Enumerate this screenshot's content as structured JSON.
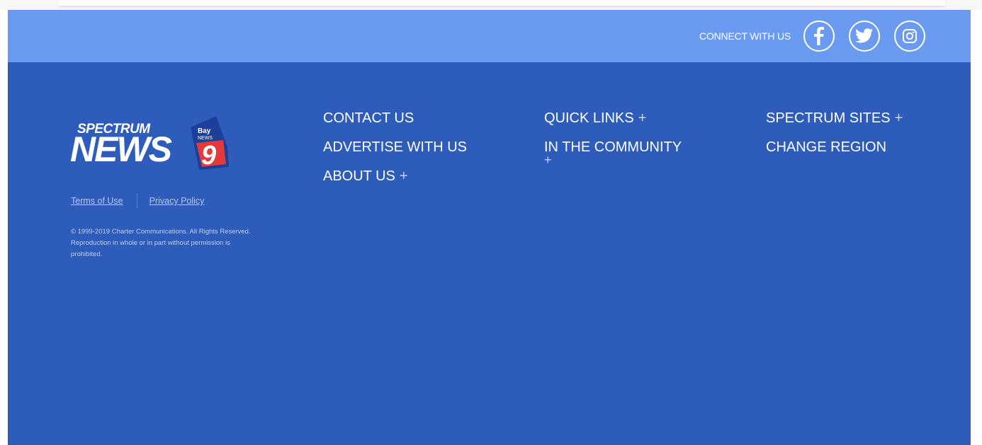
{
  "connect": {
    "label": "CONNECT WITH US",
    "social": [
      "facebook-icon",
      "twitter-icon",
      "instagram-icon"
    ]
  },
  "logo": {
    "line1": "SPECTRUM",
    "line2": "NEWS",
    "badge_top": "Bay",
    "badge_mid": "NEWS",
    "badge_num": "9"
  },
  "legal": {
    "terms": "Terms of Use",
    "privacy": "Privacy Policy",
    "copyright": "© 1999-2019 Charter Communications. All Rights Reserved. Reproduction in whole or in part without permission is prohibited."
  },
  "nav": {
    "col1": [
      "CONTACT US",
      "ADVERTISE WITH US",
      "ABOUT US"
    ],
    "col2": [
      "QUICK LINKS",
      "IN THE COMMUNITY"
    ],
    "col3": [
      "SPECTRUM SITES",
      "CHANGE REGION"
    ],
    "plus": "+"
  },
  "colors": {
    "connect_bar": "#6b9bf0",
    "footer": "#2e5cbb",
    "badge_red": "#e23a3a"
  }
}
